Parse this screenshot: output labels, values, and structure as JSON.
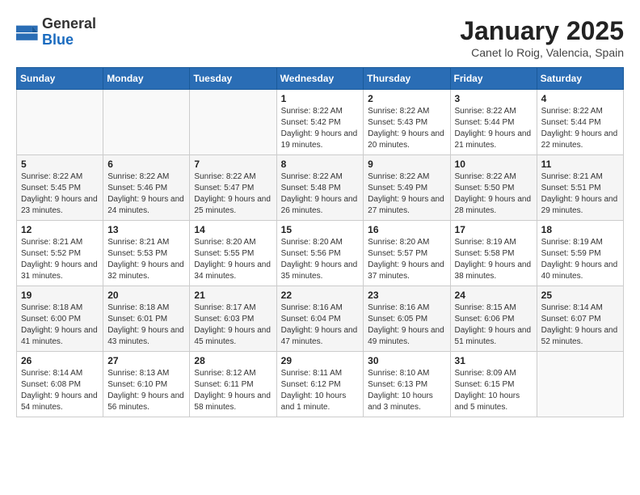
{
  "header": {
    "logo_general": "General",
    "logo_blue": "Blue",
    "title": "January 2025",
    "subtitle": "Canet lo Roig, Valencia, Spain"
  },
  "weekdays": [
    "Sunday",
    "Monday",
    "Tuesday",
    "Wednesday",
    "Thursday",
    "Friday",
    "Saturday"
  ],
  "weeks": [
    [
      {
        "day": "",
        "info": ""
      },
      {
        "day": "",
        "info": ""
      },
      {
        "day": "",
        "info": ""
      },
      {
        "day": "1",
        "info": "Sunrise: 8:22 AM\nSunset: 5:42 PM\nDaylight: 9 hours\nand 19 minutes."
      },
      {
        "day": "2",
        "info": "Sunrise: 8:22 AM\nSunset: 5:43 PM\nDaylight: 9 hours\nand 20 minutes."
      },
      {
        "day": "3",
        "info": "Sunrise: 8:22 AM\nSunset: 5:44 PM\nDaylight: 9 hours\nand 21 minutes."
      },
      {
        "day": "4",
        "info": "Sunrise: 8:22 AM\nSunset: 5:44 PM\nDaylight: 9 hours\nand 22 minutes."
      }
    ],
    [
      {
        "day": "5",
        "info": "Sunrise: 8:22 AM\nSunset: 5:45 PM\nDaylight: 9 hours\nand 23 minutes."
      },
      {
        "day": "6",
        "info": "Sunrise: 8:22 AM\nSunset: 5:46 PM\nDaylight: 9 hours\nand 24 minutes."
      },
      {
        "day": "7",
        "info": "Sunrise: 8:22 AM\nSunset: 5:47 PM\nDaylight: 9 hours\nand 25 minutes."
      },
      {
        "day": "8",
        "info": "Sunrise: 8:22 AM\nSunset: 5:48 PM\nDaylight: 9 hours\nand 26 minutes."
      },
      {
        "day": "9",
        "info": "Sunrise: 8:22 AM\nSunset: 5:49 PM\nDaylight: 9 hours\nand 27 minutes."
      },
      {
        "day": "10",
        "info": "Sunrise: 8:22 AM\nSunset: 5:50 PM\nDaylight: 9 hours\nand 28 minutes."
      },
      {
        "day": "11",
        "info": "Sunrise: 8:21 AM\nSunset: 5:51 PM\nDaylight: 9 hours\nand 29 minutes."
      }
    ],
    [
      {
        "day": "12",
        "info": "Sunrise: 8:21 AM\nSunset: 5:52 PM\nDaylight: 9 hours\nand 31 minutes."
      },
      {
        "day": "13",
        "info": "Sunrise: 8:21 AM\nSunset: 5:53 PM\nDaylight: 9 hours\nand 32 minutes."
      },
      {
        "day": "14",
        "info": "Sunrise: 8:20 AM\nSunset: 5:55 PM\nDaylight: 9 hours\nand 34 minutes."
      },
      {
        "day": "15",
        "info": "Sunrise: 8:20 AM\nSunset: 5:56 PM\nDaylight: 9 hours\nand 35 minutes."
      },
      {
        "day": "16",
        "info": "Sunrise: 8:20 AM\nSunset: 5:57 PM\nDaylight: 9 hours\nand 37 minutes."
      },
      {
        "day": "17",
        "info": "Sunrise: 8:19 AM\nSunset: 5:58 PM\nDaylight: 9 hours\nand 38 minutes."
      },
      {
        "day": "18",
        "info": "Sunrise: 8:19 AM\nSunset: 5:59 PM\nDaylight: 9 hours\nand 40 minutes."
      }
    ],
    [
      {
        "day": "19",
        "info": "Sunrise: 8:18 AM\nSunset: 6:00 PM\nDaylight: 9 hours\nand 41 minutes."
      },
      {
        "day": "20",
        "info": "Sunrise: 8:18 AM\nSunset: 6:01 PM\nDaylight: 9 hours\nand 43 minutes."
      },
      {
        "day": "21",
        "info": "Sunrise: 8:17 AM\nSunset: 6:03 PM\nDaylight: 9 hours\nand 45 minutes."
      },
      {
        "day": "22",
        "info": "Sunrise: 8:16 AM\nSunset: 6:04 PM\nDaylight: 9 hours\nand 47 minutes."
      },
      {
        "day": "23",
        "info": "Sunrise: 8:16 AM\nSunset: 6:05 PM\nDaylight: 9 hours\nand 49 minutes."
      },
      {
        "day": "24",
        "info": "Sunrise: 8:15 AM\nSunset: 6:06 PM\nDaylight: 9 hours\nand 51 minutes."
      },
      {
        "day": "25",
        "info": "Sunrise: 8:14 AM\nSunset: 6:07 PM\nDaylight: 9 hours\nand 52 minutes."
      }
    ],
    [
      {
        "day": "26",
        "info": "Sunrise: 8:14 AM\nSunset: 6:08 PM\nDaylight: 9 hours\nand 54 minutes."
      },
      {
        "day": "27",
        "info": "Sunrise: 8:13 AM\nSunset: 6:10 PM\nDaylight: 9 hours\nand 56 minutes."
      },
      {
        "day": "28",
        "info": "Sunrise: 8:12 AM\nSunset: 6:11 PM\nDaylight: 9 hours\nand 58 minutes."
      },
      {
        "day": "29",
        "info": "Sunrise: 8:11 AM\nSunset: 6:12 PM\nDaylight: 10 hours\nand 1 minute."
      },
      {
        "day": "30",
        "info": "Sunrise: 8:10 AM\nSunset: 6:13 PM\nDaylight: 10 hours\nand 3 minutes."
      },
      {
        "day": "31",
        "info": "Sunrise: 8:09 AM\nSunset: 6:15 PM\nDaylight: 10 hours\nand 5 minutes."
      },
      {
        "day": "",
        "info": ""
      }
    ]
  ]
}
